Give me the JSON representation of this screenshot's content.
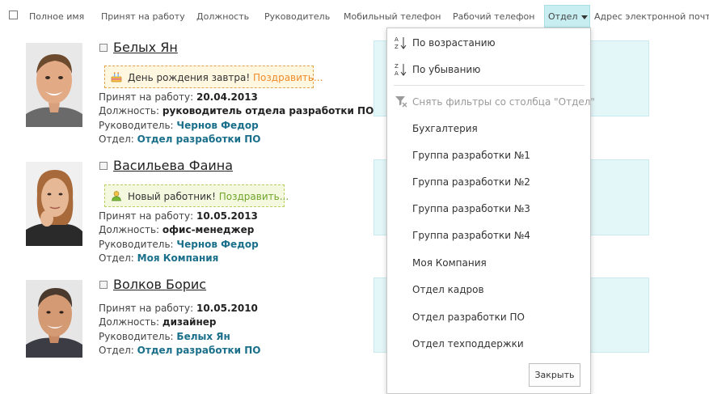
{
  "header": {
    "columns": [
      "Полное имя",
      "Принят на работу",
      "Должность",
      "Руководитель",
      "Мобильный телефон",
      "Рабочий телефон",
      "Отдел",
      "Адрес электронной почты"
    ]
  },
  "labels": {
    "hired": "Принят на работу: ",
    "position": "Должность: ",
    "manager": "Руководитель: ",
    "department": "Отдел: "
  },
  "employees": [
    {
      "name": "Белых Ян",
      "notice_text": "День рождения завтра!",
      "notice_link": "Поздравить...",
      "notice_type": "birthday",
      "hired": "20.04.2013",
      "position": "руководитель отдела разработки ПО",
      "manager": "Чернов Федор",
      "department": "Отдел разработки ПО"
    },
    {
      "name": "Васильева Фаина",
      "notice_text": "Новый работник!",
      "notice_link": "Поздравить...",
      "notice_type": "new",
      "hired": "10.05.2013",
      "position": "офис-менеджер",
      "manager": "Чернов Федор",
      "department": "Моя Компания"
    },
    {
      "name": "Волков Борис",
      "hired": "10.05.2010",
      "position": "дизайнер",
      "manager": "Белых Ян",
      "department": "Отдел разработки ПО"
    }
  ],
  "dropdown": {
    "sort_asc": "По возрастанию",
    "sort_desc": "По убыванию",
    "clear_filter": "Снять фильтры со столбца \"Отдел\"",
    "options": [
      "Бухгалтерия",
      "Группа разработки №1",
      "Группа разработки №2",
      "Группа разработки №3",
      "Группа разработки №4",
      "Моя Компания",
      "Отдел кадров",
      "Отдел разработки ПО",
      "Отдел техподдержки"
    ],
    "close_label": "Закрыть"
  },
  "colors": {
    "accent_teal": "#c9eef2",
    "link_blue": "#1a6f8a",
    "birthday_link": "#f08b2b",
    "new_link": "#71a52a"
  }
}
